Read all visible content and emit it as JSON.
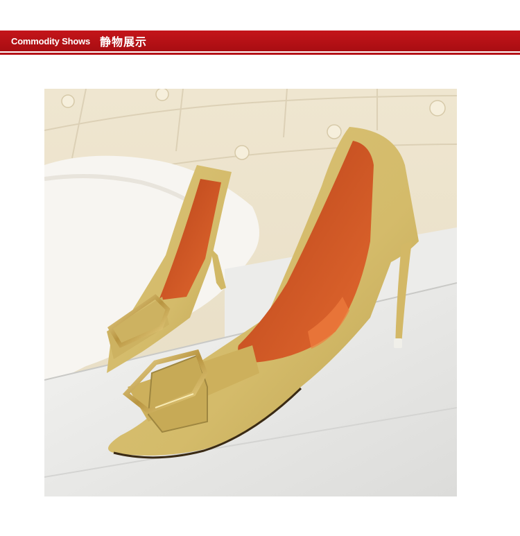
{
  "header": {
    "title_en": "Commodity Shows",
    "title_zh": "静物展示"
  },
  "product_photo": {
    "subject": "yellow suede pointed-toe stiletto pumps with metal buckle",
    "colors": {
      "shoe": "#d8c070",
      "lining": "#d85a24",
      "background": "#ece3cc",
      "banner": "#b51217"
    }
  }
}
